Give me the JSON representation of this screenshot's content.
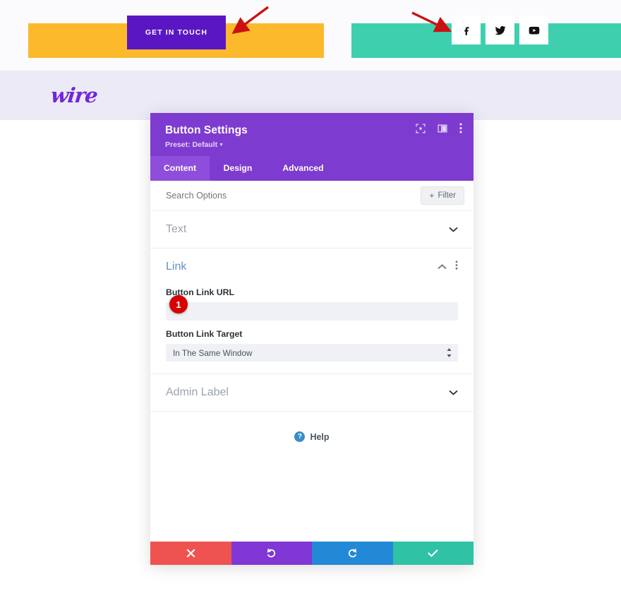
{
  "page": {
    "cta_button_label": "GET IN TOUCH",
    "logo_text": "wire",
    "social_icons": [
      {
        "name": "facebook-icon",
        "label": "Facebook"
      },
      {
        "name": "twitter-icon",
        "label": "Twitter"
      },
      {
        "name": "youtube-icon",
        "label": "YouTube"
      }
    ],
    "colors": {
      "yellow_bar": "#fcb92b",
      "teal_bar": "#3ed0ae",
      "cta_purple": "#5b16c4",
      "lavender_band": "#eceaf6",
      "logo_purple": "#7127d8",
      "annotation_red": "#cc1111"
    }
  },
  "modal": {
    "title": "Button Settings",
    "preset_label": "Preset: Default",
    "header_icons": [
      {
        "name": "fullscreen-icon",
        "label": "Expand"
      },
      {
        "name": "layout-columns-icon",
        "label": "Layout"
      },
      {
        "name": "more-options-icon",
        "label": "More Options"
      }
    ],
    "tabs": [
      {
        "label": "Content",
        "active": true
      },
      {
        "label": "Design",
        "active": false
      },
      {
        "label": "Advanced",
        "active": false
      }
    ],
    "search": {
      "placeholder": "Search Options",
      "value": ""
    },
    "filter_button": {
      "label": "Filter",
      "plus": "+"
    },
    "sections": [
      {
        "name": "text",
        "title": "Text",
        "open": false
      },
      {
        "name": "link",
        "title": "Link",
        "open": true
      },
      {
        "name": "admin-label",
        "title": "Admin Label",
        "open": false
      }
    ],
    "link_section": {
      "url_field": {
        "label": "Button Link URL",
        "value": "",
        "badge": "1"
      },
      "target_field": {
        "label": "Button Link Target",
        "value": "In The Same Window"
      }
    },
    "help": {
      "label": "Help",
      "icon_glyph": "?"
    },
    "footer_buttons": [
      {
        "name": "cancel-button",
        "glyph": "✖",
        "color": "#ef5350"
      },
      {
        "name": "undo-button",
        "glyph": "↺",
        "color": "#8137d6"
      },
      {
        "name": "redo-button",
        "glyph": "↻",
        "color": "#2389d6"
      },
      {
        "name": "save-button",
        "glyph": "✔",
        "color": "#2fc2a4"
      }
    ]
  }
}
